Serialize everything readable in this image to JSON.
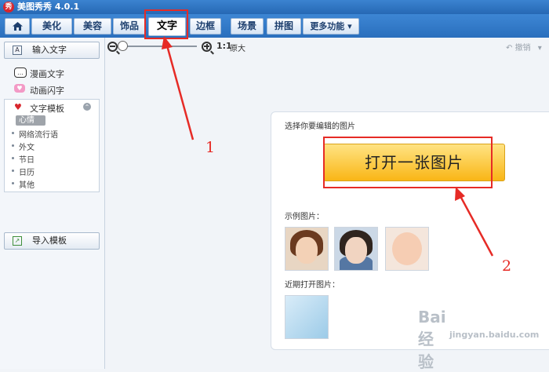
{
  "window": {
    "title": "美图秀秀 4.0.1",
    "logo_glyph": "秀"
  },
  "tabs": [
    {
      "id": "home",
      "label": "",
      "icon": "home-icon"
    },
    {
      "id": "beautify",
      "label": "美化"
    },
    {
      "id": "beauty",
      "label": "美容"
    },
    {
      "id": "accessory",
      "label": "饰品"
    },
    {
      "id": "text",
      "label": "文字",
      "active": true
    },
    {
      "id": "frame",
      "label": "边框"
    },
    {
      "id": "scene",
      "label": "场景"
    },
    {
      "id": "collage",
      "label": "拼图"
    },
    {
      "id": "more",
      "label": "更多功能 ▾"
    }
  ],
  "sidebar": {
    "input_text": {
      "label": "输入文字",
      "icon": "text-input-icon"
    },
    "comic_text": {
      "label": "漫画文字",
      "icon": "speech-bubble-icon"
    },
    "animated_text": {
      "label": "动画闪字",
      "icon": "heart-icon"
    },
    "templates": {
      "label": "文字模板",
      "icon": "love-you-icon",
      "icon_glyph": "♥",
      "collapse_glyph": "⌃",
      "items": [
        "心情",
        "网络流行语",
        "外文",
        "节日",
        "日历",
        "其他"
      ],
      "selected": 0
    },
    "import_template": {
      "label": "导入模板",
      "icon": "import-icon"
    }
  },
  "toolbar": {
    "zoom_ratio": "1:1",
    "original_label": "原大",
    "undo_label": "撤销"
  },
  "main": {
    "prompt": "选择你要编辑的图片",
    "open_button": "打开一张图片",
    "examples_label": "示例图片：",
    "recent_label": "近期打开图片："
  },
  "annotations": {
    "marker_1": "1",
    "marker_2": "2"
  },
  "watermark": {
    "brand": "Bai 经验",
    "url": "jingyan.baidu.com"
  },
  "colors": {
    "accent": "#e62b26",
    "titlebar": "#2f74c0",
    "button": "#fbc63a"
  }
}
